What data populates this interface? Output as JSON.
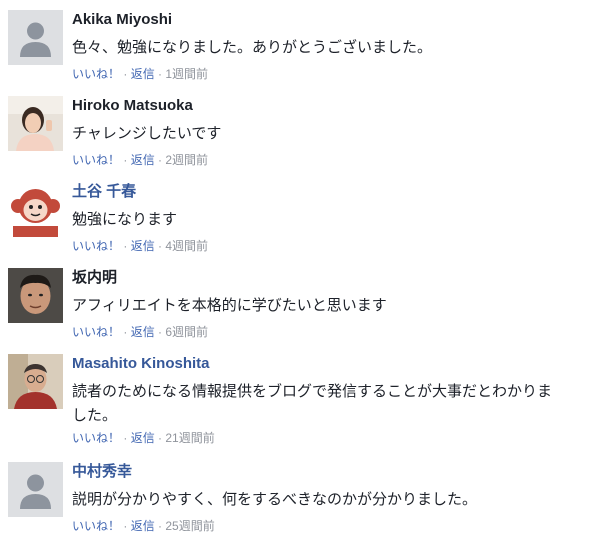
{
  "comments": [
    {
      "author": "Akika Miyoshi",
      "text": "色々、勉強になりました。ありがとうございました。",
      "like": "いいね！",
      "reply": "返信",
      "time": "1週間前",
      "avatar": "default-silhouette"
    },
    {
      "author": "Hiroko Matsuoka",
      "text": "チャレンジしたいです",
      "like": "いいね！",
      "reply": "返信",
      "time": "2週間前",
      "avatar": "photo-woman"
    },
    {
      "author": "土谷 千春",
      "text": "勉強になります",
      "like": "いいね！",
      "reply": "返信",
      "time": "4週間前",
      "avatar": "monkey-illustration"
    },
    {
      "author": "坂内明",
      "text": "アフィリエイトを本格的に学びたいと思います",
      "like": "いいね！",
      "reply": "返信",
      "time": "6週間前",
      "avatar": "photo-man"
    },
    {
      "author": "Masahito Kinoshita",
      "text": "読者のためになる情報提供をブログで発信することが大事だとわかりました。",
      "like": "いいね！",
      "reply": "返信",
      "time": "21週間前",
      "avatar": "photo-man-glasses"
    },
    {
      "author": "中村秀幸",
      "text": "説明が分かりやすく、何をするべきなのかが分かりました。",
      "like": "いいね！",
      "reply": "返信",
      "time": "25週間前",
      "avatar": "default-silhouette"
    }
  ],
  "colors": {
    "author_plain": "#1d2129",
    "author_link": "#365899",
    "action_link": "#4267b2",
    "meta_text": "#90949c"
  },
  "separator": " · "
}
